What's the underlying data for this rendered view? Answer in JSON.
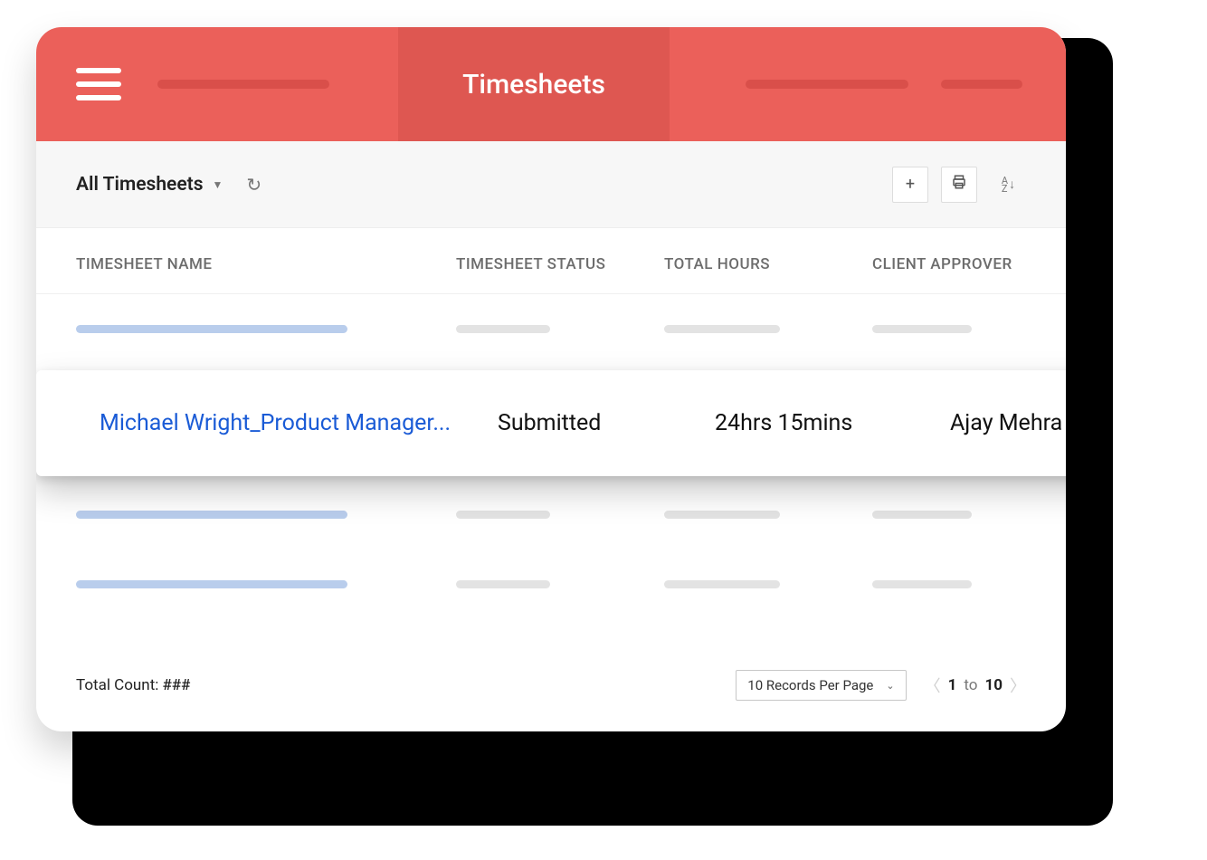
{
  "header": {
    "title": "Timesheets"
  },
  "toolbar": {
    "filter_label": "All Timesheets"
  },
  "columns": {
    "name": "TIMESHEET NAME",
    "status": "TIMESHEET STATUS",
    "hours": "TOTAL HOURS",
    "approver": "CLIENT APPROVER"
  },
  "highlighted_row": {
    "name": "Michael Wright_Product Manager...",
    "status": "Submitted",
    "hours": "24hrs 15mins",
    "approver": "Ajay Mehra"
  },
  "footer": {
    "total_label": "Total Count:",
    "total_value": "###",
    "page_select": "10 Records Per Page",
    "page_from": "1",
    "page_to_word": "to",
    "page_to": "10"
  }
}
